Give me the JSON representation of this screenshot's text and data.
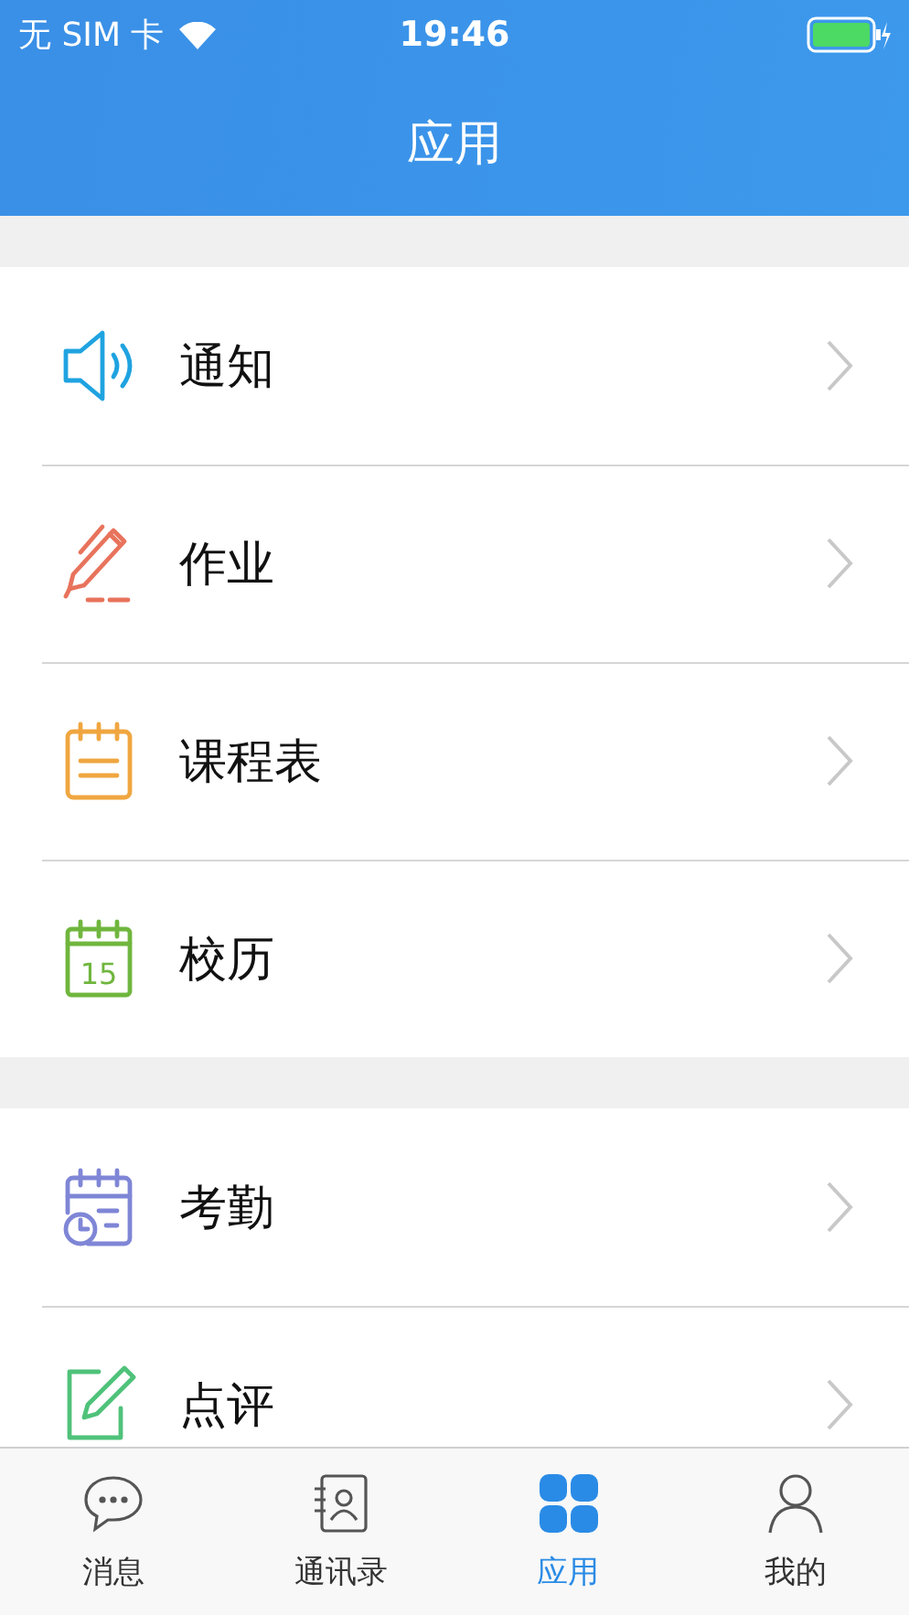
{
  "status_bar": {
    "carrier": "无 SIM 卡",
    "time": "19:46"
  },
  "nav_bar": {
    "title": "应用"
  },
  "sections": [
    {
      "items": [
        {
          "label": "通知",
          "kind": "speaker"
        },
        {
          "label": "作业",
          "kind": "pen"
        },
        {
          "label": "课程表",
          "kind": "schedule"
        },
        {
          "label": "校历",
          "kind": "calendar",
          "icon_text": "15"
        }
      ]
    },
    {
      "items": [
        {
          "label": "考勤",
          "kind": "attendance"
        },
        {
          "label": "点评",
          "kind": "edit"
        }
      ]
    }
  ],
  "tab_bar": [
    {
      "label": "消息",
      "kind": "chat",
      "selected": false
    },
    {
      "label": "通讯录",
      "kind": "contacts",
      "selected": false
    },
    {
      "label": "应用",
      "kind": "apps",
      "selected": true
    },
    {
      "label": "我的",
      "kind": "person",
      "selected": false
    }
  ]
}
